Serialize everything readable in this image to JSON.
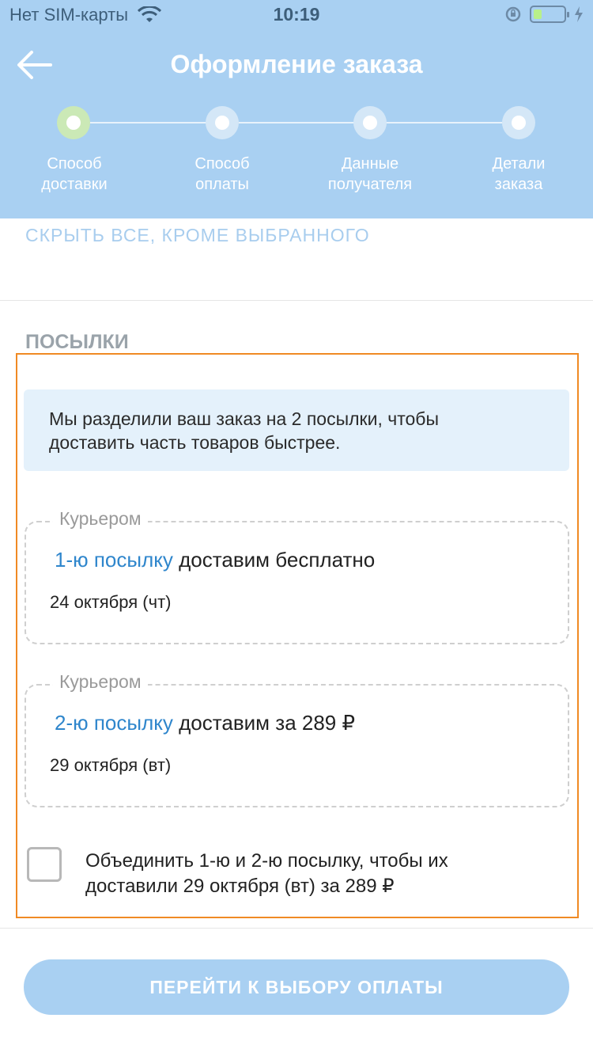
{
  "status_bar": {
    "carrier": "Нет SIM-карты",
    "time": "10:19"
  },
  "header": {
    "title": "Оформление заказа"
  },
  "stepper": {
    "steps": [
      {
        "line1": "Способ",
        "line2": "доставки",
        "active": true
      },
      {
        "line1": "Способ",
        "line2": "оплаты",
        "active": false
      },
      {
        "line1": "Данные",
        "line2": "получателя",
        "active": false
      },
      {
        "line1": "Детали",
        "line2": "заказа",
        "active": false
      }
    ]
  },
  "hide_link": "СКРЫТЬ ВСЕ, КРОМЕ ВЫБРАННОГО",
  "section_title": "ПОСЫЛКИ",
  "info": {
    "line1": "Мы разделили ваш заказ на 2 посылки, чтобы",
    "line2": "доставить часть товаров быстрее."
  },
  "parcels": [
    {
      "method": "Курьером",
      "link": "1-ю посылку",
      "text": "доставим бесплатно",
      "date": "24 октября (чт)"
    },
    {
      "method": "Курьером",
      "link": "2-ю посылку",
      "text": "доставим за 289 ₽",
      "date": "29 октября (вт)"
    }
  ],
  "combine": {
    "checked": false,
    "line1": "Объединить 1-ю и 2-ю посылку, чтобы их",
    "line2": "доставили 29 октября (вт) за 289 ₽"
  },
  "cta_label": "ПЕРЕЙТИ К ВЫБОРУ ОПЛАТЫ",
  "colors": {
    "header_bg": "#a9d0f2",
    "link": "#2f86cc",
    "highlight_border": "#f08a24",
    "info_bg": "#e4f1fb",
    "active_step": "#cbe9b6"
  }
}
